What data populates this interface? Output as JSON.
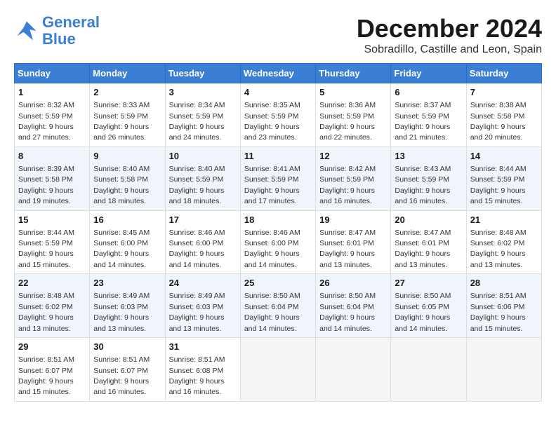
{
  "logo": {
    "line1": "General",
    "line2": "Blue"
  },
  "title": "December 2024",
  "location": "Sobradillo, Castille and Leon, Spain",
  "days_of_week": [
    "Sunday",
    "Monday",
    "Tuesday",
    "Wednesday",
    "Thursday",
    "Friday",
    "Saturday"
  ],
  "weeks": [
    [
      {
        "day": "1",
        "sunrise": "8:32 AM",
        "sunset": "5:59 PM",
        "daylight": "9 hours and 27 minutes."
      },
      {
        "day": "2",
        "sunrise": "8:33 AM",
        "sunset": "5:59 PM",
        "daylight": "9 hours and 26 minutes."
      },
      {
        "day": "3",
        "sunrise": "8:34 AM",
        "sunset": "5:59 PM",
        "daylight": "9 hours and 24 minutes."
      },
      {
        "day": "4",
        "sunrise": "8:35 AM",
        "sunset": "5:59 PM",
        "daylight": "9 hours and 23 minutes."
      },
      {
        "day": "5",
        "sunrise": "8:36 AM",
        "sunset": "5:59 PM",
        "daylight": "9 hours and 22 minutes."
      },
      {
        "day": "6",
        "sunrise": "8:37 AM",
        "sunset": "5:59 PM",
        "daylight": "9 hours and 21 minutes."
      },
      {
        "day": "7",
        "sunrise": "8:38 AM",
        "sunset": "5:58 PM",
        "daylight": "9 hours and 20 minutes."
      }
    ],
    [
      {
        "day": "8",
        "sunrise": "8:39 AM",
        "sunset": "5:58 PM",
        "daylight": "9 hours and 19 minutes."
      },
      {
        "day": "9",
        "sunrise": "8:40 AM",
        "sunset": "5:58 PM",
        "daylight": "9 hours and 18 minutes."
      },
      {
        "day": "10",
        "sunrise": "8:40 AM",
        "sunset": "5:59 PM",
        "daylight": "9 hours and 18 minutes."
      },
      {
        "day": "11",
        "sunrise": "8:41 AM",
        "sunset": "5:59 PM",
        "daylight": "9 hours and 17 minutes."
      },
      {
        "day": "12",
        "sunrise": "8:42 AM",
        "sunset": "5:59 PM",
        "daylight": "9 hours and 16 minutes."
      },
      {
        "day": "13",
        "sunrise": "8:43 AM",
        "sunset": "5:59 PM",
        "daylight": "9 hours and 16 minutes."
      },
      {
        "day": "14",
        "sunrise": "8:44 AM",
        "sunset": "5:59 PM",
        "daylight": "9 hours and 15 minutes."
      }
    ],
    [
      {
        "day": "15",
        "sunrise": "8:44 AM",
        "sunset": "5:59 PM",
        "daylight": "9 hours and 15 minutes."
      },
      {
        "day": "16",
        "sunrise": "8:45 AM",
        "sunset": "6:00 PM",
        "daylight": "9 hours and 14 minutes."
      },
      {
        "day": "17",
        "sunrise": "8:46 AM",
        "sunset": "6:00 PM",
        "daylight": "9 hours and 14 minutes."
      },
      {
        "day": "18",
        "sunrise": "8:46 AM",
        "sunset": "6:00 PM",
        "daylight": "9 hours and 14 minutes."
      },
      {
        "day": "19",
        "sunrise": "8:47 AM",
        "sunset": "6:01 PM",
        "daylight": "9 hours and 13 minutes."
      },
      {
        "day": "20",
        "sunrise": "8:47 AM",
        "sunset": "6:01 PM",
        "daylight": "9 hours and 13 minutes."
      },
      {
        "day": "21",
        "sunrise": "8:48 AM",
        "sunset": "6:02 PM",
        "daylight": "9 hours and 13 minutes."
      }
    ],
    [
      {
        "day": "22",
        "sunrise": "8:48 AM",
        "sunset": "6:02 PM",
        "daylight": "9 hours and 13 minutes."
      },
      {
        "day": "23",
        "sunrise": "8:49 AM",
        "sunset": "6:03 PM",
        "daylight": "9 hours and 13 minutes."
      },
      {
        "day": "24",
        "sunrise": "8:49 AM",
        "sunset": "6:03 PM",
        "daylight": "9 hours and 13 minutes."
      },
      {
        "day": "25",
        "sunrise": "8:50 AM",
        "sunset": "6:04 PM",
        "daylight": "9 hours and 14 minutes."
      },
      {
        "day": "26",
        "sunrise": "8:50 AM",
        "sunset": "6:04 PM",
        "daylight": "9 hours and 14 minutes."
      },
      {
        "day": "27",
        "sunrise": "8:50 AM",
        "sunset": "6:05 PM",
        "daylight": "9 hours and 14 minutes."
      },
      {
        "day": "28",
        "sunrise": "8:51 AM",
        "sunset": "6:06 PM",
        "daylight": "9 hours and 15 minutes."
      }
    ],
    [
      {
        "day": "29",
        "sunrise": "8:51 AM",
        "sunset": "6:07 PM",
        "daylight": "9 hours and 15 minutes."
      },
      {
        "day": "30",
        "sunrise": "8:51 AM",
        "sunset": "6:07 PM",
        "daylight": "9 hours and 16 minutes."
      },
      {
        "day": "31",
        "sunrise": "8:51 AM",
        "sunset": "6:08 PM",
        "daylight": "9 hours and 16 minutes."
      },
      null,
      null,
      null,
      null
    ]
  ]
}
